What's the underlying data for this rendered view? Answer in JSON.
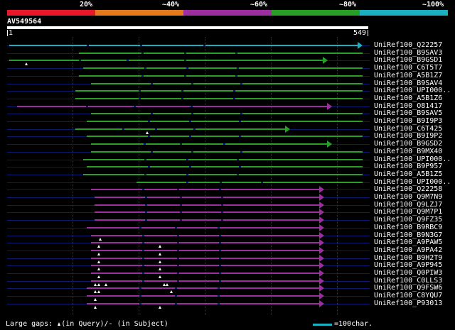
{
  "header": {
    "percent_labels": [
      "20%",
      "~40%",
      "~60%",
      "~80%",
      "~100%"
    ],
    "color_scale": [
      "#e8182a",
      "#e47a1c",
      "#9c2ea0",
      "#28a028",
      "#1ab0c0"
    ]
  },
  "query": {
    "id": "AV549564",
    "start": "1",
    "end": "549"
  },
  "hits": [
    {
      "label": "UniRef100_Q22257",
      "color": "#1ab0c0",
      "start": 4,
      "end": 549,
      "arrow": true
    },
    {
      "label": "UniRef100_B9SAV3",
      "color": "#28a028",
      "start": 112,
      "end": 549,
      "arrow": false
    },
    {
      "label": "UniRef100_B9GSD1",
      "color": "#28a028",
      "start": 4,
      "end": 495,
      "arrow": true,
      "qgaps": [
        31
      ]
    },
    {
      "label": "UniRef100_C6T5T7",
      "color": "#28a028",
      "start": 118,
      "end": 549,
      "arrow": false
    },
    {
      "label": "UniRef100_A5B1Z7",
      "color": "#28a028",
      "start": 112,
      "end": 549,
      "arrow": false
    },
    {
      "label": "UniRef100_B9SAV4",
      "color": "#28a028",
      "start": 130,
      "end": 549,
      "arrow": false
    },
    {
      "label": "UniRef100_UPI000..",
      "color": "#28a028",
      "start": 106,
      "end": 549,
      "arrow": false
    },
    {
      "label": "UniRef100_A5B1Z6",
      "color": "#28a028",
      "start": 106,
      "end": 549,
      "arrow": false
    },
    {
      "label": "UniRef100_O81417",
      "color": "#9c2ea0",
      "start": 16,
      "end": 502,
      "arrow": true
    },
    {
      "label": "UniRef100_B9SAV5",
      "color": "#28a028",
      "start": 130,
      "end": 549,
      "arrow": false
    },
    {
      "label": "UniRef100_B9I9P3",
      "color": "#28a028",
      "start": 124,
      "end": 549,
      "arrow": false
    },
    {
      "label": "UniRef100_C6T425",
      "color": "#28a028",
      "start": 106,
      "end": 437,
      "arrow": true,
      "qgaps": [
        217
      ]
    },
    {
      "label": "UniRef100_B9I9P2",
      "color": "#28a028",
      "start": 124,
      "end": 549,
      "arrow": false
    },
    {
      "label": "UniRef100_B9GSD2",
      "color": "#28a028",
      "start": 130,
      "end": 502,
      "arrow": true
    },
    {
      "label": "UniRef100_B9MX40",
      "color": "#28a028",
      "start": 130,
      "end": 549,
      "arrow": false
    },
    {
      "label": "UniRef100_UPI000..",
      "color": "#28a028",
      "start": 118,
      "end": 549,
      "arrow": false
    },
    {
      "label": "UniRef100_B9P957",
      "color": "#28a028",
      "start": 124,
      "end": 549,
      "arrow": false
    },
    {
      "label": "UniRef100_A5B1Z5",
      "color": "#28a028",
      "start": 118,
      "end": 549,
      "arrow": false
    },
    {
      "label": "UniRef100_UPI000..",
      "color": "#28a028",
      "start": 200,
      "end": 549,
      "arrow": false
    },
    {
      "label": "UniRef100_Q22258",
      "color": "#9c2ea0",
      "start": 130,
      "end": 490,
      "arrow": true
    },
    {
      "label": "UniRef100_Q9M7N9",
      "color": "#9c2ea0",
      "start": 136,
      "end": 490,
      "arrow": true
    },
    {
      "label": "UniRef100_Q9LZJ7",
      "color": "#9c2ea0",
      "start": 136,
      "end": 490,
      "arrow": true
    },
    {
      "label": "UniRef100_Q9M7P1",
      "color": "#9c2ea0",
      "start": 136,
      "end": 490,
      "arrow": true
    },
    {
      "label": "UniRef100_Q9FZ35",
      "color": "#9c2ea0",
      "start": 136,
      "end": 490,
      "arrow": true
    },
    {
      "label": "UniRef100_B9RBC9",
      "color": "#9c2ea0",
      "start": 124,
      "end": 490,
      "arrow": true
    },
    {
      "label": "UniRef100_B9N3G7",
      "color": "#9c2ea0",
      "start": 130,
      "end": 490,
      "arrow": true,
      "qgaps": [
        145
      ]
    },
    {
      "label": "UniRef100_A9PAW5",
      "color": "#9c2ea0",
      "start": 130,
      "end": 490,
      "arrow": true,
      "qgaps": [
        142,
        237
      ]
    },
    {
      "label": "UniRef100_A9PA42",
      "color": "#9c2ea0",
      "start": 130,
      "end": 490,
      "arrow": true,
      "qgaps": [
        142,
        237
      ]
    },
    {
      "label": "UniRef100_B9H2T9",
      "color": "#9c2ea0",
      "start": 130,
      "end": 490,
      "arrow": true,
      "qgaps": [
        142,
        237
      ]
    },
    {
      "label": "UniRef100_A9P945",
      "color": "#9c2ea0",
      "start": 130,
      "end": 490,
      "arrow": true,
      "qgaps": [
        142,
        237
      ]
    },
    {
      "label": "UniRef100_Q0PIW3",
      "color": "#9c2ea0",
      "start": 130,
      "end": 490,
      "arrow": true,
      "qgaps": [
        142,
        237
      ]
    },
    {
      "label": "UniRef100_C0LLS3",
      "color": "#9c2ea0",
      "start": 130,
      "end": 490,
      "arrow": true,
      "qgaps": [
        137,
        142,
        153,
        243,
        248
      ]
    },
    {
      "label": "UniRef100_Q9FSW6",
      "color": "#9c2ea0",
      "start": 124,
      "end": 490,
      "arrow": true,
      "qgaps": [
        137,
        142,
        254
      ]
    },
    {
      "label": "UniRef100_C8YQU7",
      "color": "#9c2ea0",
      "start": 124,
      "end": 490,
      "arrow": true,
      "qgaps": [
        137
      ]
    },
    {
      "label": "UniRef100_P93013",
      "color": "#9c2ea0",
      "start": 124,
      "end": 490,
      "arrow": true,
      "qgaps": [
        137,
        237
      ]
    }
  ],
  "footer": {
    "gaps_prefix": "Large gaps:",
    "gaps_query": "(in Query)/",
    "gaps_subject": "(in Subject)",
    "scale_text": "=100char."
  }
}
